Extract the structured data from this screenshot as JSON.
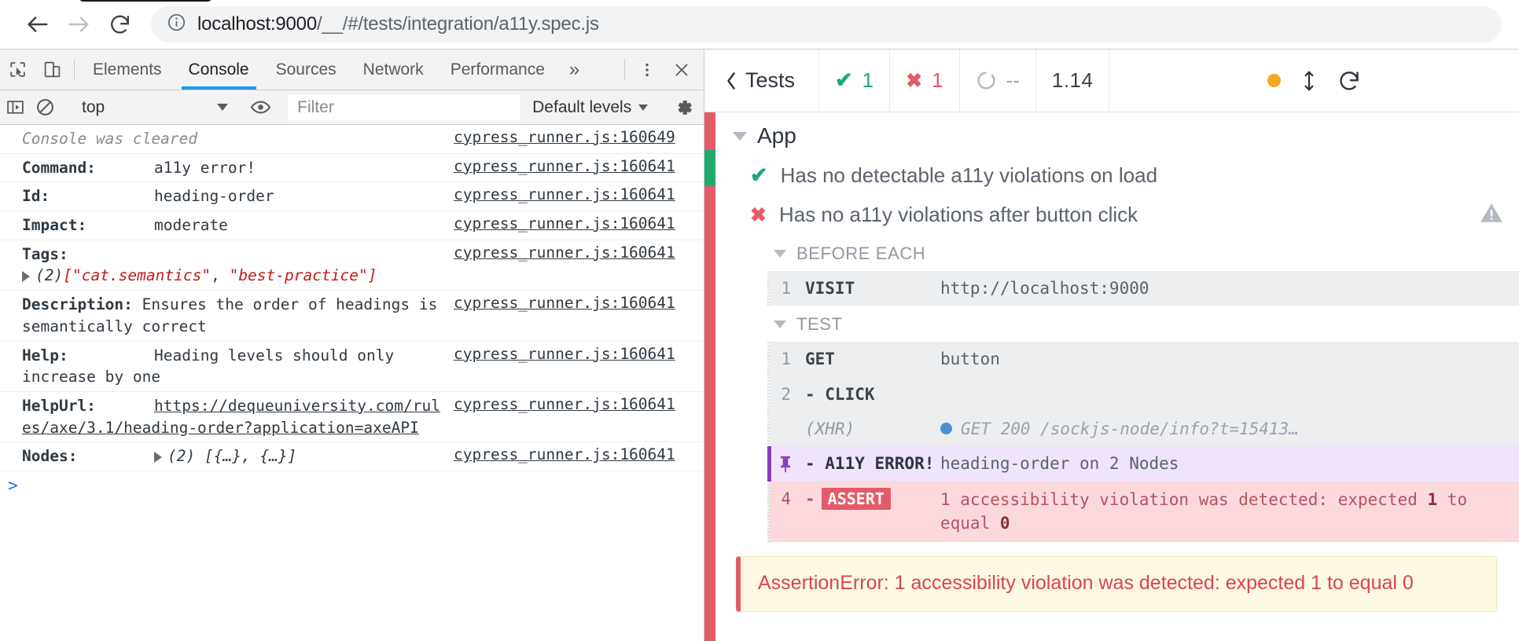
{
  "browser": {
    "back_label": "back-arrow",
    "forward_label": "forward-arrow",
    "reload_label": "reload",
    "url_host": "localhost:9000",
    "url_path": "/__/#/tests/integration/a11y.spec.js",
    "url_full": "localhost:9000/__/#/tests/integration/a11y.spec.js",
    "info_icon": "info-circle-icon"
  },
  "devtools": {
    "tabs": [
      {
        "label": "Elements",
        "active": false
      },
      {
        "label": "Console",
        "active": true
      },
      {
        "label": "Sources",
        "active": false
      },
      {
        "label": "Network",
        "active": false
      },
      {
        "label": "Performance",
        "active": false
      }
    ],
    "overflow_label": "»",
    "icons": {
      "inspect": "inspect-element-icon",
      "device": "device-toolbar-icon",
      "more": "more-vertical-icon",
      "close": "close-icon",
      "sidebar": "console-sidebar-icon",
      "clear": "clear-console-icon",
      "eye": "live-expression-eye-icon",
      "settings": "gear-icon"
    },
    "filterbar": {
      "context": "top",
      "filter_placeholder": "Filter",
      "filter_value": "",
      "levels": "Default levels"
    },
    "console": {
      "cleared_message": "Console was cleared",
      "source_cleared": "cypress_runner.js:160649",
      "source_default": "cypress_runner.js:160641",
      "rows": [
        {
          "label": "Command:",
          "value": "a11y error!"
        },
        {
          "label": "Id:",
          "value": "heading-order"
        },
        {
          "label": "Impact:",
          "value": "moderate"
        }
      ],
      "tags": {
        "label": "Tags:",
        "count": "(2)",
        "open": "[",
        "close": "]",
        "items": [
          "\"cat.semantics\"",
          "\"best-practice\""
        ],
        "separator": ", "
      },
      "description": {
        "label": "Description:",
        "value": "Ensures the order of headings is semantically correct"
      },
      "help": {
        "label": "Help:",
        "value": "Heading levels should only increase by one"
      },
      "helpurl": {
        "label": "HelpUrl:",
        "value": "https://dequeuniversity.com/rules/axe/3.1/heading-order?application=axeAPI"
      },
      "nodes": {
        "label": "Nodes:",
        "count": "(2)",
        "preview": "[{…}, {…}]"
      },
      "prompt": ">"
    }
  },
  "cypress": {
    "header": {
      "back_label": "Tests",
      "passed": "1",
      "failed": "1",
      "pending": "--",
      "duration": "1.14",
      "selector_playground_icon": "selector-playground-icon",
      "viewport_icon": "viewport-size-icon",
      "restart_icon": "restart-icon"
    },
    "suite": "App",
    "tests": [
      {
        "status": "passed",
        "title": "Has no detectable a11y violations on load"
      },
      {
        "status": "failed",
        "title": "Has no a11y violations after button click",
        "warning_icon": "warning-triangle-icon"
      }
    ],
    "hooks": [
      {
        "name": "BEFORE EACH",
        "commands": [
          {
            "num": "1",
            "name": "VISIT",
            "message": "http://localhost:9000",
            "type": "normal"
          }
        ]
      },
      {
        "name": "TEST",
        "commands": [
          {
            "num": "1",
            "name": "GET",
            "message": "button",
            "type": "normal"
          },
          {
            "num": "2",
            "name": "- CLICK",
            "message": "",
            "type": "normal"
          },
          {
            "num": "",
            "name": "(XHR)",
            "message": "GET 200 /sockjs-node/info?t=15413…",
            "type": "xhr"
          },
          {
            "num": "pin",
            "name": "- A11Y ERROR!",
            "message": "heading-order on 2 Nodes",
            "type": "a11y"
          },
          {
            "num": "4",
            "name": "-",
            "badge": "ASSERT",
            "message_parts": [
              "1 accessibility violation was detected: expected ",
              "1",
              " to equal ",
              "0"
            ],
            "type": "assert"
          }
        ]
      }
    ],
    "error_banner": "AssertionError: 1 accessibility violation was detected: expected 1 to equal 0"
  },
  "colors": {
    "accent_blue": "#1a9aee",
    "pass_green": "#1fa971",
    "fail_red": "#e45b68",
    "a11y_purple": "#8a3fc0",
    "xhr_blue": "#4a90d9",
    "warn_orange": "#f5a623",
    "banner_bg": "#fdf9e2"
  }
}
